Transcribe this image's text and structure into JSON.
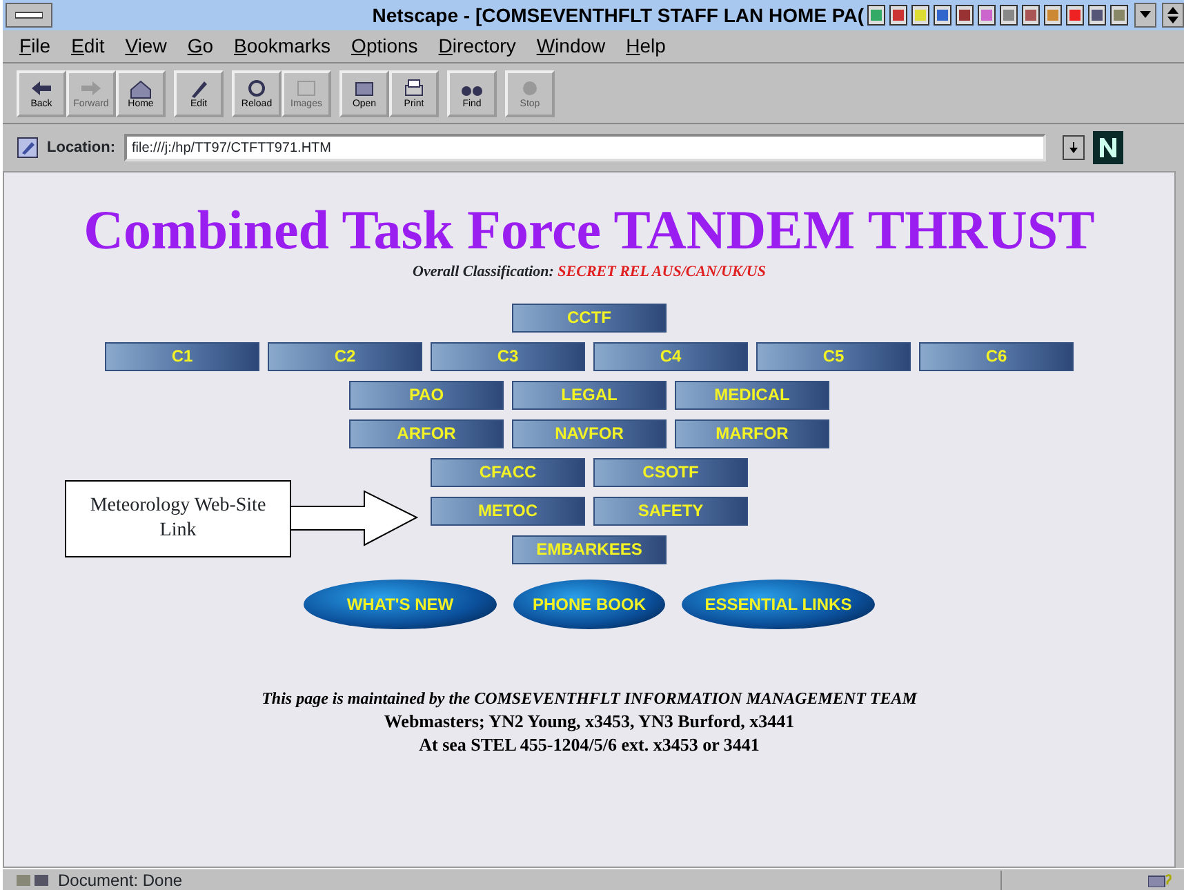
{
  "window": {
    "title": "Netscape - [COMSEVENTHFLT STAFF LAN HOME PA("
  },
  "menu": [
    "File",
    "Edit",
    "View",
    "Go",
    "Bookmarks",
    "Options",
    "Directory",
    "Window",
    "Help"
  ],
  "toolbar": [
    {
      "label": "Back",
      "disabled": false
    },
    {
      "label": "Forward",
      "disabled": true
    },
    {
      "label": "Home",
      "disabled": false
    },
    {
      "label": "Edit",
      "disabled": false
    },
    {
      "label": "Reload",
      "disabled": false
    },
    {
      "label": "Images",
      "disabled": true
    },
    {
      "label": "Open",
      "disabled": false
    },
    {
      "label": "Print",
      "disabled": false
    },
    {
      "label": "Find",
      "disabled": false
    },
    {
      "label": "Stop",
      "disabled": true
    }
  ],
  "location": {
    "label": "Location:",
    "value": "file:///j:/hp/TT97/CTFTT971.HTM"
  },
  "page": {
    "heading": "Combined Task Force TANDEM THRUST",
    "classification_label": "Overall Classification:",
    "classification": "SECRET REL AUS/CAN/UK/US",
    "nav_rows": [
      [
        "CCTF"
      ],
      [
        "C1",
        "C2",
        "C3",
        "C4",
        "C5",
        "C6"
      ],
      [
        "PAO",
        "LEGAL",
        "MEDICAL"
      ],
      [
        "ARFOR",
        "NAVFOR",
        "MARFOR"
      ],
      [
        "CFACC",
        "CSOTF"
      ],
      [
        "METOC",
        "SAFETY"
      ],
      [
        "EMBARKEES"
      ]
    ],
    "oval_buttons": [
      "WHAT'S NEW",
      "PHONE BOOK",
      "ESSENTIAL LINKS"
    ],
    "callout": "Meteorology Web-Site Link",
    "footer": {
      "maintainer": "This page is maintained by the COMSEVENTHFLT INFORMATION MANAGEMENT TEAM",
      "webmasters": "Webmasters; YN2 Young, x3453, YN3 Burford, x3441",
      "phone": "At sea STEL 455-1204/5/6 ext. x3453 or 3441"
    }
  },
  "status_bar": {
    "text": "Document: Done"
  }
}
